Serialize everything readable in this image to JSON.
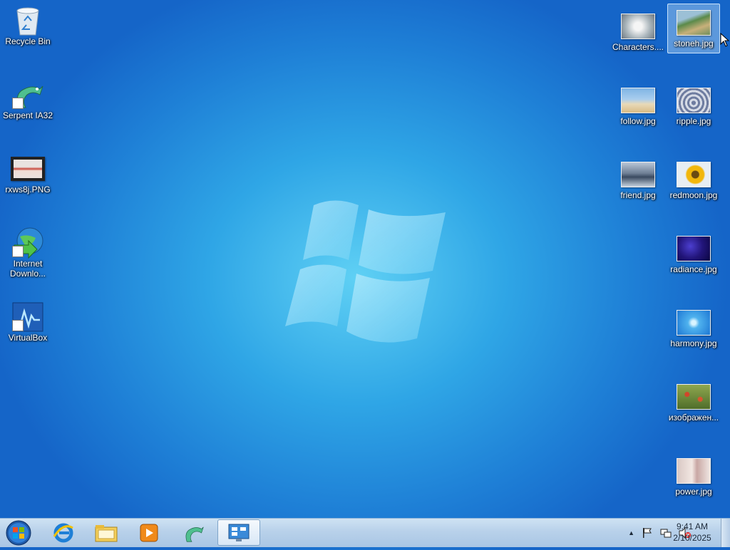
{
  "desktop": {
    "left_icons": [
      {
        "label": "Recycle Bin",
        "icon": "recycle-bin-icon"
      },
      {
        "label": "Serpent IA32",
        "icon": "serpent-icon"
      },
      {
        "label": "rxws8j.PNG",
        "icon": "png-file-icon"
      },
      {
        "label": "Internet Downlo...",
        "icon": "internet-download-manager-icon"
      },
      {
        "label": "VirtualBox",
        "icon": "virtualbox-icon"
      }
    ],
    "right_icons": [
      {
        "label": "Characters....",
        "icon": "image-file-icon"
      },
      {
        "label": "stoneh.jpg",
        "icon": "image-file-icon",
        "selected": true
      },
      {
        "label": "follow.jpg",
        "icon": "image-file-icon"
      },
      {
        "label": "ripple.jpg",
        "icon": "image-file-icon"
      },
      {
        "label": "friend.jpg",
        "icon": "image-file-icon"
      },
      {
        "label": "redmoon.jpg",
        "icon": "image-file-icon"
      },
      {
        "label": "radiance.jpg",
        "icon": "image-file-icon"
      },
      {
        "label": "harmony.jpg",
        "icon": "image-file-icon"
      },
      {
        "label": "изображен...",
        "icon": "image-file-icon"
      },
      {
        "label": "power.jpg",
        "icon": "image-file-icon"
      }
    ]
  },
  "taskbar": {
    "pinned": [
      "start-orb-icon",
      "internet-explorer-icon",
      "file-explorer-icon",
      "media-player-icon",
      "serpent-icon",
      "control-panel-icon"
    ],
    "time": "9:41 AM",
    "date": "2/10/2025",
    "tray_icons": [
      "show-hidden-icons-icon",
      "action-center-flag-icon",
      "network-icon",
      "volume-muted-icon"
    ]
  },
  "colors": {
    "desktop_bg": "#1e7fd6",
    "taskbar_bg": "#b8d1ea"
  }
}
